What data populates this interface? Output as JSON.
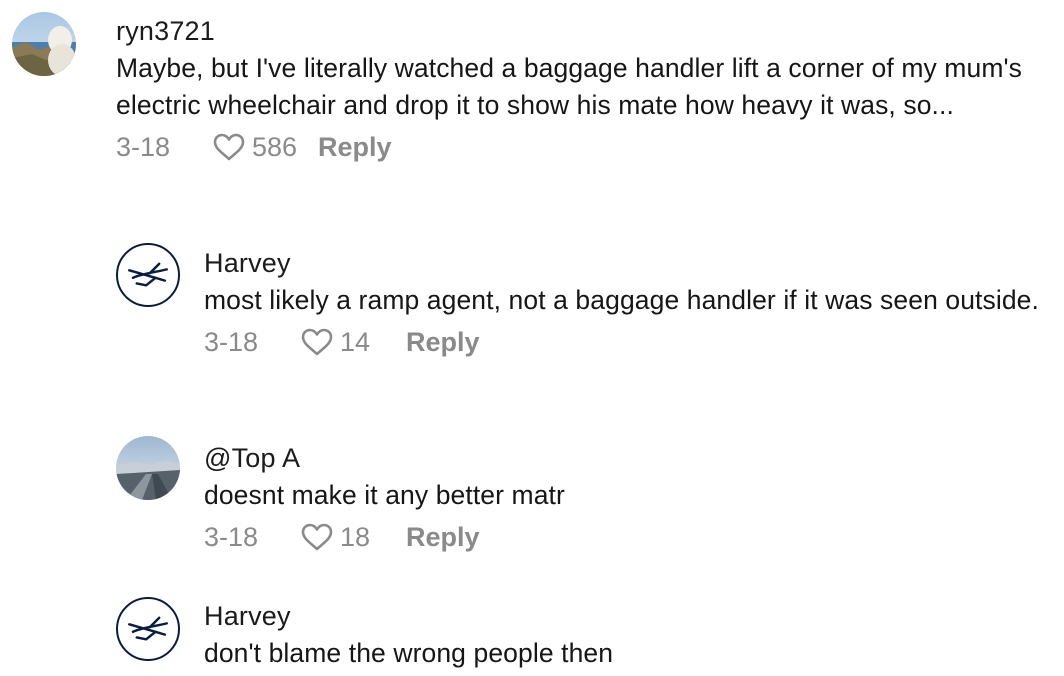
{
  "comments": [
    {
      "username": "ryn3721",
      "text": "Maybe, but I've literally watched a baggage handler lift a corner of my mum's electric wheelchair and drop it to show his mate how heavy it was, so...",
      "date": "3-18",
      "likes": "586",
      "reply_label": "Reply",
      "avatar_icon": "beach-photo-avatar"
    },
    {
      "username": "Harvey",
      "text": "most likely a ramp agent, not a baggage handler if it was seen outside.",
      "date": "3-18",
      "likes": "14",
      "reply_label": "Reply",
      "avatar_icon": "crane-logo-avatar"
    },
    {
      "username": "@Top A",
      "text": "doesnt make it any better matr",
      "date": "3-18",
      "likes": "18",
      "reply_label": "Reply",
      "avatar_icon": "landscape-photo-avatar"
    },
    {
      "username": "Harvey",
      "text": "don't blame the wrong people then",
      "avatar_icon": "crane-logo-avatar"
    }
  ],
  "colors": {
    "text": "#161616",
    "meta": "#8a8a8a",
    "logo_navy": "#0a1d3d"
  },
  "icons": {
    "like": "heart-outline-icon"
  }
}
